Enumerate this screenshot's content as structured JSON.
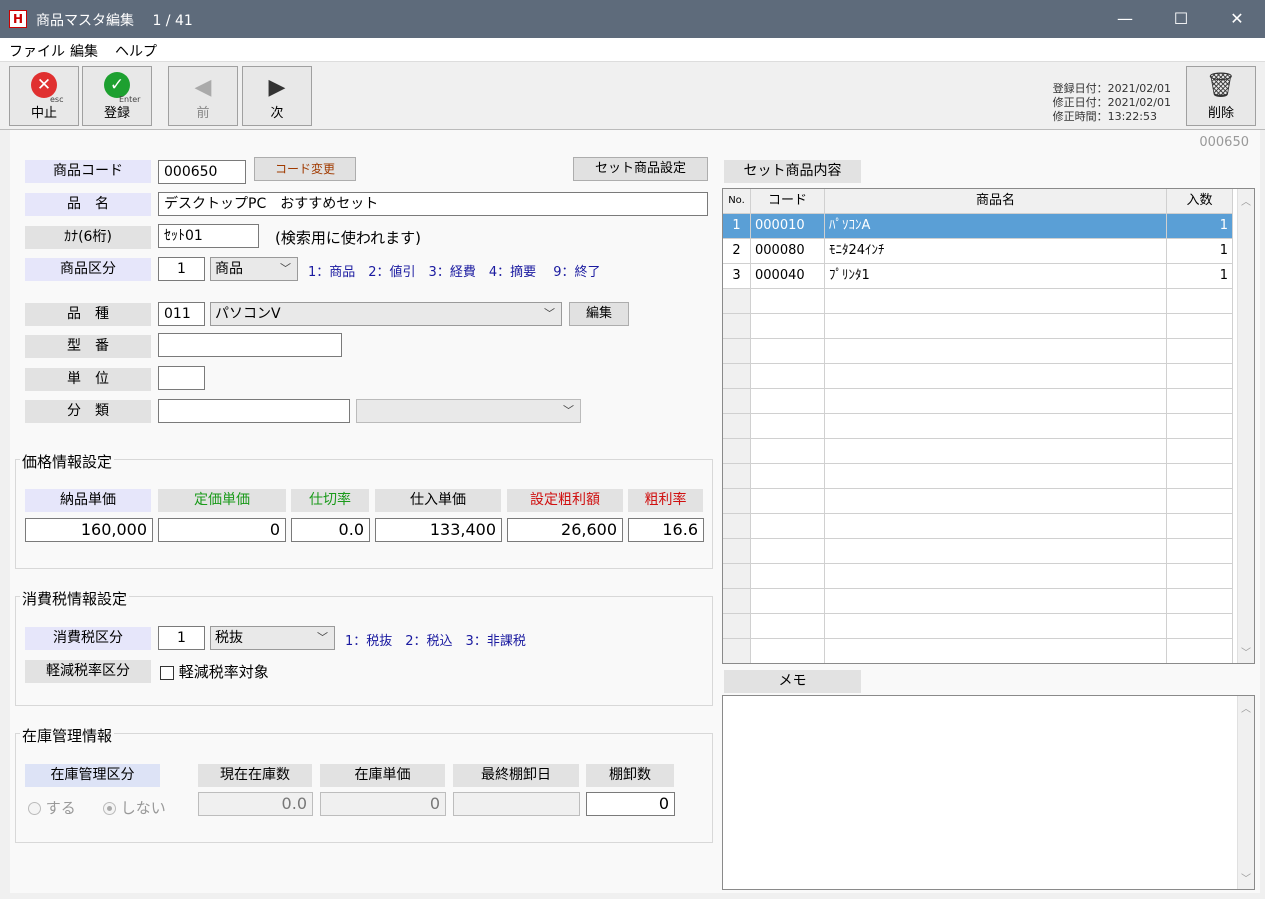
{
  "window": {
    "app_icon": "H",
    "title": "商品マスタ編集　 1 / 41",
    "min": "—",
    "max": "☐",
    "close": "✕"
  },
  "menu": [
    "ファイル",
    "編集",
    "ヘルプ"
  ],
  "toolbar": {
    "cancel": {
      "label": "中止",
      "sub": "esc"
    },
    "register": {
      "label": "登録",
      "sub": "Enter"
    },
    "prev": {
      "label": "前"
    },
    "next": {
      "label": "次"
    },
    "delete": {
      "label": "削除"
    },
    "registered_date": "登録日付：2021/02/01",
    "modified_date": "修正日付：2021/02/01",
    "modified_time": "修正時間：13:22:53"
  },
  "record_code": "000650",
  "form": {
    "code_label": "商品コード",
    "code_value": "000650",
    "code_change_btn": "コード変更",
    "set_setting_btn": "セット商品設定",
    "name_label": "品　名",
    "name_value": "デスクトップPC　おすすめセット",
    "kana_label": "ｶﾅ(6桁)",
    "kana_value": "ｾｯﾄ01",
    "kana_hint": "(検索用に使われます)",
    "category_label": "商品区分",
    "category_num": "1",
    "category_value": "商品",
    "category_hint": "1：商品　2：値引　3：経費　4：摘要　 9：終了",
    "kind_label": "品　種",
    "kind_num": "011",
    "kind_value": "パソコンV",
    "kind_edit_btn": "編集",
    "model_label": "型　番",
    "model_value": "",
    "unit_label": "単　位",
    "unit_value": "",
    "class_label": "分　類",
    "class_value": "",
    "class_select": ""
  },
  "price": {
    "group_title": "価格情報設定",
    "cols": [
      "納品単価",
      "定価単価",
      "仕切率",
      "仕入単価",
      "設定粗利額",
      "粗利率"
    ],
    "values": [
      "160,000",
      "0",
      "0.0",
      "133,400",
      "26,600",
      "16.6"
    ]
  },
  "tax": {
    "group_title": "消費税情報設定",
    "tax_label": "消費税区分",
    "tax_num": "1",
    "tax_value": "税抜",
    "tax_hint": "1：税抜　2：税込　3：非課税",
    "reduced_label": "軽減税率区分",
    "reduced_check": "軽減税率対象"
  },
  "stock": {
    "group_title": "在庫管理情報",
    "cols": [
      "在庫管理区分",
      "現在在庫数",
      "在庫単価",
      "最終棚卸日",
      "棚卸数"
    ],
    "radio_yes": "する",
    "radio_no": "しない",
    "current_qty": "0.0",
    "unit_price": "0",
    "last_date": "",
    "count": "0"
  },
  "set_table": {
    "title": "セット商品内容",
    "headers": [
      "No.",
      "コード",
      "商品名",
      "入数"
    ],
    "rows": [
      {
        "no": "1",
        "code": "000010",
        "name": "ﾊﾟｿｺﾝA",
        "qty": "1"
      },
      {
        "no": "2",
        "code": "000080",
        "name": "ﾓﾆﾀ24ｲﾝﾁ",
        "qty": "1"
      },
      {
        "no": "3",
        "code": "000040",
        "name": "ﾌﾟﾘﾝﾀ1",
        "qty": "1"
      }
    ]
  },
  "memo": {
    "title": "メモ",
    "value": ""
  },
  "colors": {
    "titlebar": "#5e6b7b",
    "selected_row": "#5a9fd6",
    "label_bg": "#e6e6fa",
    "red": "#d01010",
    "green": "#1a9a1a"
  }
}
